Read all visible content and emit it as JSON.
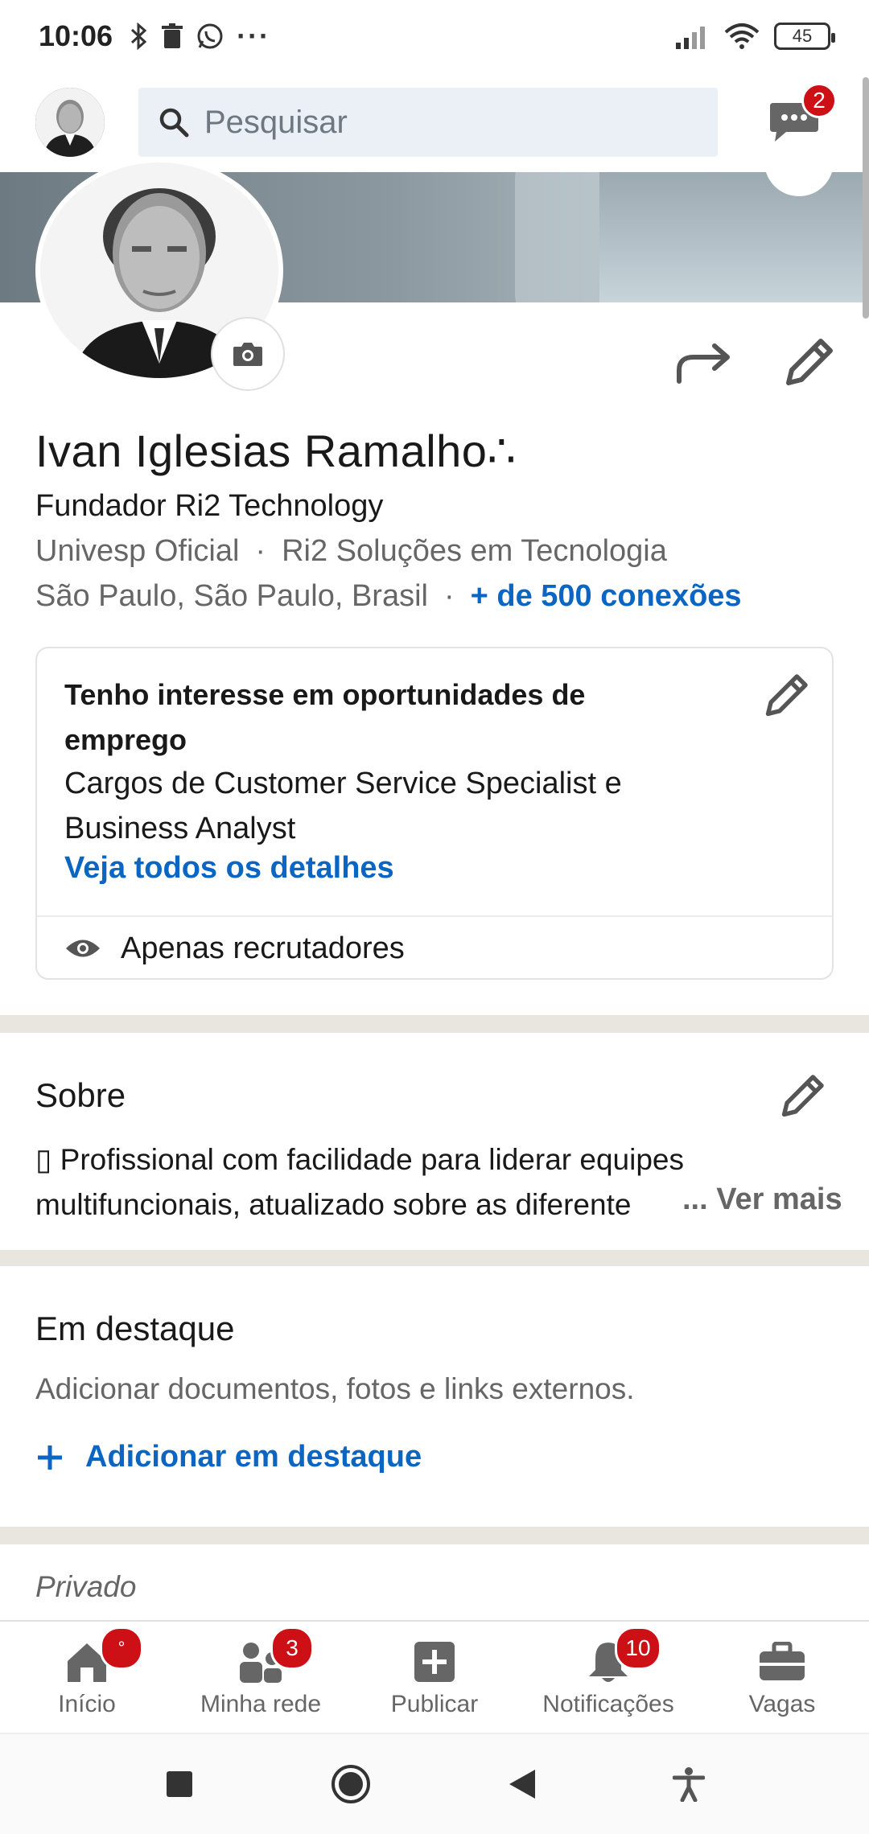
{
  "status_bar": {
    "time": "10:06",
    "battery": "45",
    "more": "···"
  },
  "top_bar": {
    "search_placeholder": "Pesquisar",
    "messages_badge": "2"
  },
  "profile": {
    "name": "Ivan Iglesias Ramalho∴",
    "headline": "Fundador Ri2 Technology",
    "education": "Univesp Oficial",
    "company": "Ri2 Soluções em Tecnologia",
    "location": "São Paulo, São Paulo, Brasil",
    "connections": "+ de 500 conexões",
    "separator": "·"
  },
  "open_to_work": {
    "title": "Tenho interesse em oportunidades de emprego",
    "description": "Cargos de Customer Service Specialist e Business Analyst",
    "details_link": "Veja todos os detalhes",
    "visibility": "Apenas recrutadores"
  },
  "about": {
    "title": "Sobre",
    "text_line1": "▯ Profissional com facilidade para liderar equipes",
    "text_line2": "multifuncionais, atualizado sobre as diferente",
    "more": "... Ver mais"
  },
  "featured": {
    "title": "Em destaque",
    "description": "Adicionar documentos, fotos e links externos.",
    "add_label": "Adicionar em destaque"
  },
  "private_section": {
    "label": "Privado"
  },
  "bottom_nav": {
    "items": [
      {
        "label": "Início",
        "badge": "°",
        "icon": "home-icon"
      },
      {
        "label": "Minha rede",
        "badge": "3",
        "icon": "network-icon"
      },
      {
        "label": "Publicar",
        "badge": "",
        "icon": "post-icon"
      },
      {
        "label": "Notificações",
        "badge": "10",
        "icon": "bell-icon"
      },
      {
        "label": "Vagas",
        "badge": "",
        "icon": "briefcase-icon"
      }
    ]
  },
  "colors": {
    "link_blue": "#0a66c2",
    "badge_red": "#cc1016",
    "separator": "#e9e5df"
  }
}
